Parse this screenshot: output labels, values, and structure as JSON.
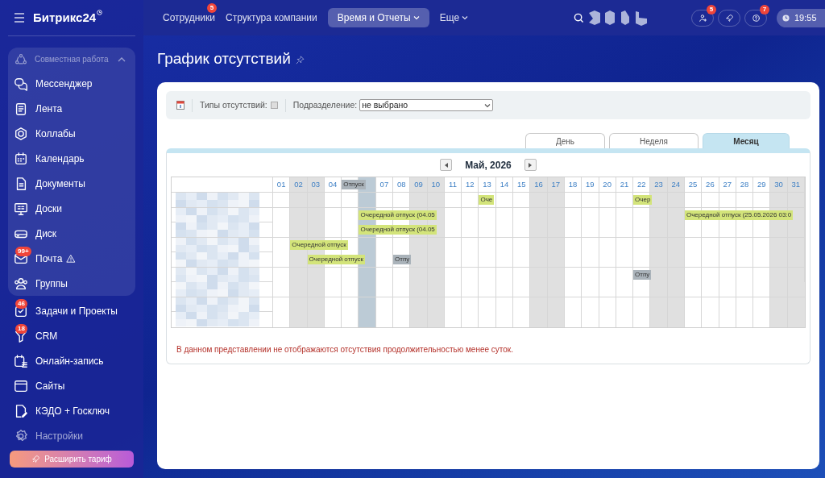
{
  "sidebar": {
    "logo": "Битрикс24",
    "group": {
      "title": "Совместная работа",
      "expanded": true,
      "items": [
        {
          "label": "Мессенджер"
        },
        {
          "label": "Лента"
        },
        {
          "label": "Коллабы"
        },
        {
          "label": "Календарь"
        },
        {
          "label": "Документы"
        },
        {
          "label": "Доски"
        },
        {
          "label": "Диск"
        },
        {
          "label": "Почта",
          "badge": "99+",
          "warning": true
        },
        {
          "label": "Группы"
        }
      ]
    },
    "items": [
      {
        "label": "Задачи и Проекты",
        "badge": "46",
        "muted": false
      },
      {
        "label": "CRM",
        "badge": "18",
        "muted": false
      },
      {
        "label": "Онлайн-запись",
        "muted": false
      },
      {
        "label": "Сайты",
        "muted": false
      },
      {
        "label": "КЭДО + Госключ",
        "muted": false
      },
      {
        "label": "Настройки",
        "muted": true
      }
    ],
    "upgrade_button": "Расширить тариф"
  },
  "topbar": {
    "nav": [
      {
        "label": "Сотрудники",
        "badge": "5",
        "selected": false,
        "dropdown": false
      },
      {
        "label": "Структура компании",
        "selected": false,
        "dropdown": false
      },
      {
        "label": "Время и Отчеты",
        "selected": true,
        "dropdown": true
      },
      {
        "label": "Еще",
        "selected": false,
        "dropdown": true
      }
    ],
    "actions": [
      {
        "kind": "invite",
        "badge": "5"
      },
      {
        "kind": "rocket"
      },
      {
        "kind": "help",
        "badge": "7"
      }
    ],
    "clock": "19:55"
  },
  "page": {
    "title": "График отсутствий"
  },
  "toolbar": {
    "types_label": "Типы отсутствий:",
    "types_checked": false,
    "department_label": "Подразделение:",
    "department_value": "не выбрано"
  },
  "tabs": [
    {
      "label": "День",
      "selected": false
    },
    {
      "label": "Неделя",
      "selected": false
    },
    {
      "label": "Месяц",
      "selected": true
    }
  ],
  "calendar": {
    "title": "Май, 2026",
    "days": [
      {
        "label": "01",
        "weekend": false,
        "today": false
      },
      {
        "label": "02",
        "weekend": true,
        "today": false
      },
      {
        "label": "03",
        "weekend": true,
        "today": false
      },
      {
        "label": "04",
        "weekend": false,
        "today": false
      },
      {
        "weekend": false,
        "today": false,
        "absence": {
          "text": "Отпуск",
          "kind": "other"
        }
      },
      {
        "weekend": false,
        "today": true
      },
      {
        "label": "07",
        "weekend": false,
        "today": false
      },
      {
        "label": "08",
        "weekend": false,
        "today": false
      },
      {
        "label": "09",
        "weekend": true,
        "today": false
      },
      {
        "label": "10",
        "weekend": true,
        "today": false
      },
      {
        "label": "11",
        "weekend": false,
        "today": false
      },
      {
        "label": "12",
        "weekend": false,
        "today": false
      },
      {
        "label": "13",
        "weekend": false,
        "today": false
      },
      {
        "label": "14",
        "weekend": false,
        "today": false
      },
      {
        "label": "15",
        "weekend": false,
        "today": false
      },
      {
        "label": "16",
        "weekend": true,
        "today": false
      },
      {
        "label": "17",
        "weekend": true,
        "today": false
      },
      {
        "label": "18",
        "weekend": false,
        "today": false
      },
      {
        "label": "19",
        "weekend": false,
        "today": false
      },
      {
        "label": "20",
        "weekend": false,
        "today": false
      },
      {
        "label": "21",
        "weekend": false,
        "today": false
      },
      {
        "label": "22",
        "weekend": false,
        "today": false
      },
      {
        "label": "23",
        "weekend": true,
        "today": false
      },
      {
        "label": "24",
        "weekend": true,
        "today": false
      },
      {
        "label": "25",
        "weekend": false,
        "today": false
      },
      {
        "label": "26",
        "weekend": false,
        "today": false
      },
      {
        "label": "27",
        "weekend": false,
        "today": false
      },
      {
        "label": "28",
        "weekend": false,
        "today": false
      },
      {
        "label": "29",
        "weekend": false,
        "today": false
      },
      {
        "label": "30",
        "weekend": true,
        "today": false
      },
      {
        "label": "31",
        "weekend": true,
        "today": false
      }
    ],
    "rows": [
      {
        "cells": [
          {
            "weekend": false,
            "today": false
          },
          {
            "weekend": true,
            "today": false
          },
          {
            "weekend": true,
            "today": false
          },
          {
            "weekend": false,
            "today": false
          },
          {
            "weekend": false,
            "today": false
          },
          {
            "weekend": false,
            "today": true
          },
          {
            "weekend": false,
            "today": false
          },
          {
            "weekend": false,
            "today": false
          },
          {
            "weekend": true,
            "today": false
          },
          {
            "weekend": true,
            "today": false
          },
          {
            "weekend": false,
            "today": false
          },
          {
            "weekend": false,
            "today": false
          },
          {
            "weekend": false,
            "today": false,
            "absence": {
              "text": "Оче",
              "kind": "vacation"
            }
          },
          {
            "weekend": false,
            "today": false
          },
          {
            "weekend": false,
            "today": false
          },
          {
            "weekend": true,
            "today": false
          },
          {
            "weekend": true,
            "today": false
          },
          {
            "weekend": false,
            "today": false
          },
          {
            "weekend": false,
            "today": false
          },
          {
            "weekend": false,
            "today": false
          },
          {
            "weekend": false,
            "today": false
          },
          {
            "weekend": false,
            "today": false,
            "absence": {
              "text": "Очер",
              "kind": "vacation"
            }
          },
          {
            "weekend": true,
            "today": false
          },
          {
            "weekend": true,
            "today": false
          },
          {
            "weekend": false,
            "today": false
          },
          {
            "weekend": false,
            "today": false
          },
          {
            "weekend": false,
            "today": false
          },
          {
            "weekend": false,
            "today": false
          },
          {
            "weekend": false,
            "today": false
          },
          {
            "weekend": true,
            "today": false
          },
          {
            "weekend": true,
            "today": false
          }
        ]
      },
      {
        "cells": [
          {
            "weekend": false,
            "today": false
          },
          {
            "weekend": true,
            "today": false
          },
          {
            "weekend": true,
            "today": false
          },
          {
            "weekend": false,
            "today": false
          },
          {
            "weekend": false,
            "today": false
          },
          {
            "weekend": false,
            "today": true,
            "absence": {
              "text": "Очередной отпуск (04.05",
              "kind": "vacation"
            }
          },
          {
            "weekend": false,
            "today": false
          },
          {
            "weekend": false,
            "today": false
          },
          {
            "weekend": true,
            "today": false
          },
          {
            "weekend": true,
            "today": false
          },
          {
            "weekend": false,
            "today": false
          },
          {
            "weekend": false,
            "today": false
          },
          {
            "weekend": false,
            "today": false
          },
          {
            "weekend": false,
            "today": false
          },
          {
            "weekend": false,
            "today": false
          },
          {
            "weekend": true,
            "today": false
          },
          {
            "weekend": true,
            "today": false
          },
          {
            "weekend": false,
            "today": false
          },
          {
            "weekend": false,
            "today": false
          },
          {
            "weekend": false,
            "today": false
          },
          {
            "weekend": false,
            "today": false
          },
          {
            "weekend": false,
            "today": false
          },
          {
            "weekend": true,
            "today": false
          },
          {
            "weekend": true,
            "today": false
          },
          {
            "weekend": false,
            "today": false,
            "absence": {
              "text": "Очередной отпуск (25.05.2026 03:0",
              "kind": "vacation"
            }
          },
          {
            "weekend": false,
            "today": false
          },
          {
            "weekend": false,
            "today": false
          },
          {
            "weekend": false,
            "today": false
          },
          {
            "weekend": false,
            "today": false
          },
          {
            "weekend": true,
            "today": false
          },
          {
            "weekend": true,
            "today": false
          }
        ]
      },
      {
        "cells": [
          {
            "weekend": false,
            "today": false
          },
          {
            "weekend": true,
            "today": false
          },
          {
            "weekend": true,
            "today": false
          },
          {
            "weekend": false,
            "today": false
          },
          {
            "weekend": false,
            "today": false
          },
          {
            "weekend": false,
            "today": true,
            "absence": {
              "text": "Очередной отпуск (04.05",
              "kind": "vacation"
            }
          },
          {
            "weekend": false,
            "today": false
          },
          {
            "weekend": false,
            "today": false
          },
          {
            "weekend": true,
            "today": false
          },
          {
            "weekend": true,
            "today": false
          },
          {
            "weekend": false,
            "today": false
          },
          {
            "weekend": false,
            "today": false
          },
          {
            "weekend": false,
            "today": false
          },
          {
            "weekend": false,
            "today": false
          },
          {
            "weekend": false,
            "today": false
          },
          {
            "weekend": true,
            "today": false
          },
          {
            "weekend": true,
            "today": false
          },
          {
            "weekend": false,
            "today": false
          },
          {
            "weekend": false,
            "today": false
          },
          {
            "weekend": false,
            "today": false
          },
          {
            "weekend": false,
            "today": false
          },
          {
            "weekend": false,
            "today": false
          },
          {
            "weekend": true,
            "today": false
          },
          {
            "weekend": true,
            "today": false
          },
          {
            "weekend": false,
            "today": false
          },
          {
            "weekend": false,
            "today": false
          },
          {
            "weekend": false,
            "today": false
          },
          {
            "weekend": false,
            "today": false
          },
          {
            "weekend": false,
            "today": false
          },
          {
            "weekend": true,
            "today": false
          },
          {
            "weekend": true,
            "today": false
          }
        ]
      },
      {
        "cells": [
          {
            "weekend": false,
            "today": false
          },
          {
            "weekend": true,
            "today": false,
            "absence": {
              "text": "Очередной отпуск",
              "kind": "vacation"
            }
          },
          {
            "weekend": true,
            "today": false
          },
          {
            "weekend": false,
            "today": false
          },
          {
            "weekend": false,
            "today": false
          },
          {
            "weekend": false,
            "today": true
          },
          {
            "weekend": false,
            "today": false
          },
          {
            "weekend": false,
            "today": false
          },
          {
            "weekend": true,
            "today": false
          },
          {
            "weekend": true,
            "today": false
          },
          {
            "weekend": false,
            "today": false
          },
          {
            "weekend": false,
            "today": false
          },
          {
            "weekend": false,
            "today": false
          },
          {
            "weekend": false,
            "today": false
          },
          {
            "weekend": false,
            "today": false
          },
          {
            "weekend": true,
            "today": false
          },
          {
            "weekend": true,
            "today": false
          },
          {
            "weekend": false,
            "today": false
          },
          {
            "weekend": false,
            "today": false
          },
          {
            "weekend": false,
            "today": false
          },
          {
            "weekend": false,
            "today": false
          },
          {
            "weekend": false,
            "today": false
          },
          {
            "weekend": true,
            "today": false
          },
          {
            "weekend": true,
            "today": false
          },
          {
            "weekend": false,
            "today": false
          },
          {
            "weekend": false,
            "today": false
          },
          {
            "weekend": false,
            "today": false
          },
          {
            "weekend": false,
            "today": false
          },
          {
            "weekend": false,
            "today": false
          },
          {
            "weekend": true,
            "today": false
          },
          {
            "weekend": true,
            "today": false
          }
        ]
      },
      {
        "cells": [
          {
            "weekend": false,
            "today": false
          },
          {
            "weekend": true,
            "today": false
          },
          {
            "weekend": true,
            "today": false,
            "absence": {
              "text": "Очередной отпуск",
              "kind": "vacation"
            }
          },
          {
            "weekend": false,
            "today": false
          },
          {
            "weekend": false,
            "today": false
          },
          {
            "weekend": false,
            "today": true
          },
          {
            "weekend": false,
            "today": false
          },
          {
            "weekend": false,
            "today": false,
            "absence": {
              "text": "Отпу",
              "kind": "other"
            }
          },
          {
            "weekend": true,
            "today": false
          },
          {
            "weekend": true,
            "today": false
          },
          {
            "weekend": false,
            "today": false
          },
          {
            "weekend": false,
            "today": false
          },
          {
            "weekend": false,
            "today": false
          },
          {
            "weekend": false,
            "today": false
          },
          {
            "weekend": false,
            "today": false
          },
          {
            "weekend": true,
            "today": false
          },
          {
            "weekend": true,
            "today": false
          },
          {
            "weekend": false,
            "today": false
          },
          {
            "weekend": false,
            "today": false
          },
          {
            "weekend": false,
            "today": false
          },
          {
            "weekend": false,
            "today": false
          },
          {
            "weekend": false,
            "today": false
          },
          {
            "weekend": true,
            "today": false
          },
          {
            "weekend": true,
            "today": false
          },
          {
            "weekend": false,
            "today": false
          },
          {
            "weekend": false,
            "today": false
          },
          {
            "weekend": false,
            "today": false
          },
          {
            "weekend": false,
            "today": false
          },
          {
            "weekend": false,
            "today": false
          },
          {
            "weekend": true,
            "today": false
          },
          {
            "weekend": true,
            "today": false
          }
        ]
      },
      {
        "cells": [
          {
            "weekend": false,
            "today": false
          },
          {
            "weekend": true,
            "today": false
          },
          {
            "weekend": true,
            "today": false
          },
          {
            "weekend": false,
            "today": false
          },
          {
            "weekend": false,
            "today": false
          },
          {
            "weekend": false,
            "today": true
          },
          {
            "weekend": false,
            "today": false
          },
          {
            "weekend": false,
            "today": false
          },
          {
            "weekend": true,
            "today": false
          },
          {
            "weekend": true,
            "today": false
          },
          {
            "weekend": false,
            "today": false
          },
          {
            "weekend": false,
            "today": false
          },
          {
            "weekend": false,
            "today": false
          },
          {
            "weekend": false,
            "today": false
          },
          {
            "weekend": false,
            "today": false
          },
          {
            "weekend": true,
            "today": false
          },
          {
            "weekend": true,
            "today": false
          },
          {
            "weekend": false,
            "today": false
          },
          {
            "weekend": false,
            "today": false
          },
          {
            "weekend": false,
            "today": false
          },
          {
            "weekend": false,
            "today": false
          },
          {
            "weekend": false,
            "today": false,
            "absence": {
              "text": "Отпу",
              "kind": "other"
            }
          },
          {
            "weekend": true,
            "today": false
          },
          {
            "weekend": true,
            "today": false
          },
          {
            "weekend": false,
            "today": false
          },
          {
            "weekend": false,
            "today": false
          },
          {
            "weekend": false,
            "today": false
          },
          {
            "weekend": false,
            "today": false
          },
          {
            "weekend": false,
            "today": false
          },
          {
            "weekend": true,
            "today": false
          },
          {
            "weekend": true,
            "today": false
          }
        ]
      },
      {
        "cells": [
          {
            "weekend": false,
            "today": false
          },
          {
            "weekend": true,
            "today": false
          },
          {
            "weekend": true,
            "today": false
          },
          {
            "weekend": false,
            "today": false
          },
          {
            "weekend": false,
            "today": false
          },
          {
            "weekend": false,
            "today": true
          },
          {
            "weekend": false,
            "today": false
          },
          {
            "weekend": false,
            "today": false
          },
          {
            "weekend": true,
            "today": false
          },
          {
            "weekend": true,
            "today": false
          },
          {
            "weekend": false,
            "today": false
          },
          {
            "weekend": false,
            "today": false
          },
          {
            "weekend": false,
            "today": false
          },
          {
            "weekend": false,
            "today": false
          },
          {
            "weekend": false,
            "today": false
          },
          {
            "weekend": true,
            "today": false
          },
          {
            "weekend": true,
            "today": false
          },
          {
            "weekend": false,
            "today": false
          },
          {
            "weekend": false,
            "today": false
          },
          {
            "weekend": false,
            "today": false
          },
          {
            "weekend": false,
            "today": false
          },
          {
            "weekend": false,
            "today": false
          },
          {
            "weekend": true,
            "today": false
          },
          {
            "weekend": true,
            "today": false
          },
          {
            "weekend": false,
            "today": false
          },
          {
            "weekend": false,
            "today": false
          },
          {
            "weekend": false,
            "today": false
          },
          {
            "weekend": false,
            "today": false
          },
          {
            "weekend": false,
            "today": false
          },
          {
            "weekend": true,
            "today": false
          },
          {
            "weekend": true,
            "today": false
          }
        ]
      },
      {
        "cells": [
          {
            "weekend": false,
            "today": false
          },
          {
            "weekend": true,
            "today": false
          },
          {
            "weekend": true,
            "today": false
          },
          {
            "weekend": false,
            "today": false
          },
          {
            "weekend": false,
            "today": false
          },
          {
            "weekend": false,
            "today": true
          },
          {
            "weekend": false,
            "today": false
          },
          {
            "weekend": false,
            "today": false
          },
          {
            "weekend": true,
            "today": false
          },
          {
            "weekend": true,
            "today": false
          },
          {
            "weekend": false,
            "today": false
          },
          {
            "weekend": false,
            "today": false
          },
          {
            "weekend": false,
            "today": false
          },
          {
            "weekend": false,
            "today": false
          },
          {
            "weekend": false,
            "today": false
          },
          {
            "weekend": true,
            "today": false
          },
          {
            "weekend": true,
            "today": false
          },
          {
            "weekend": false,
            "today": false
          },
          {
            "weekend": false,
            "today": false
          },
          {
            "weekend": false,
            "today": false
          },
          {
            "weekend": false,
            "today": false
          },
          {
            "weekend": false,
            "today": false
          },
          {
            "weekend": true,
            "today": false
          },
          {
            "weekend": true,
            "today": false
          },
          {
            "weekend": false,
            "today": false
          },
          {
            "weekend": false,
            "today": false
          },
          {
            "weekend": false,
            "today": false
          },
          {
            "weekend": false,
            "today": false
          },
          {
            "weekend": false,
            "today": false
          },
          {
            "weekend": true,
            "today": false
          },
          {
            "weekend": true,
            "today": false
          }
        ]
      },
      {
        "cells": [
          {
            "weekend": false,
            "today": false
          },
          {
            "weekend": true,
            "today": false
          },
          {
            "weekend": true,
            "today": false
          },
          {
            "weekend": false,
            "today": false
          },
          {
            "weekend": false,
            "today": false
          },
          {
            "weekend": false,
            "today": true
          },
          {
            "weekend": false,
            "today": false
          },
          {
            "weekend": false,
            "today": false
          },
          {
            "weekend": true,
            "today": false
          },
          {
            "weekend": true,
            "today": false
          },
          {
            "weekend": false,
            "today": false
          },
          {
            "weekend": false,
            "today": false
          },
          {
            "weekend": false,
            "today": false
          },
          {
            "weekend": false,
            "today": false
          },
          {
            "weekend": false,
            "today": false
          },
          {
            "weekend": true,
            "today": false
          },
          {
            "weekend": true,
            "today": false
          },
          {
            "weekend": false,
            "today": false
          },
          {
            "weekend": false,
            "today": false
          },
          {
            "weekend": false,
            "today": false
          },
          {
            "weekend": false,
            "today": false
          },
          {
            "weekend": false,
            "today": false
          },
          {
            "weekend": true,
            "today": false
          },
          {
            "weekend": true,
            "today": false
          },
          {
            "weekend": false,
            "today": false
          },
          {
            "weekend": false,
            "today": false
          },
          {
            "weekend": false,
            "today": false
          },
          {
            "weekend": false,
            "today": false
          },
          {
            "weekend": false,
            "today": false
          },
          {
            "weekend": true,
            "today": false
          },
          {
            "weekend": true,
            "today": false
          }
        ]
      }
    ]
  },
  "note": "В данном представлении не отображаются отсутствия продолжительностью менее суток."
}
